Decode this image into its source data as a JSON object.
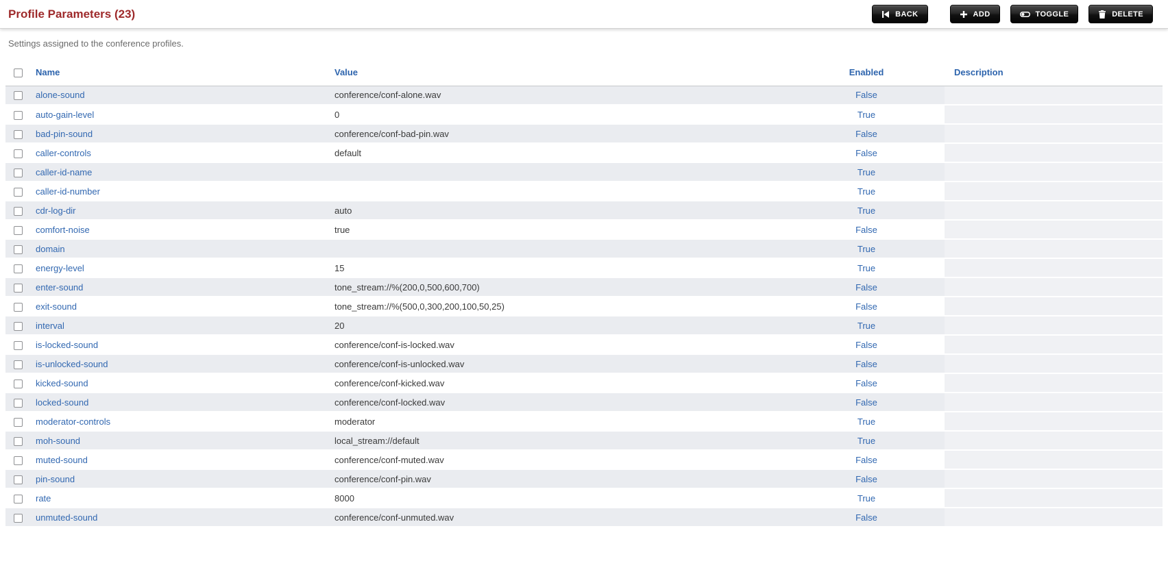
{
  "header": {
    "title": "Profile Parameters (23)",
    "buttons": {
      "back": {
        "label": "BACK",
        "icon": "skip-back-icon"
      },
      "add": {
        "label": "ADD",
        "icon": "plus-icon"
      },
      "toggle": {
        "label": "TOGGLE",
        "icon": "toggle-icon"
      },
      "delete": {
        "label": "DELETE",
        "icon": "trash-icon"
      }
    }
  },
  "subtitle": "Settings assigned to the conference profiles.",
  "table": {
    "columns": [
      "Name",
      "Value",
      "Enabled",
      "Description"
    ],
    "rows": [
      {
        "name": "alone-sound",
        "value": "conference/conf-alone.wav",
        "enabled": "False",
        "description": ""
      },
      {
        "name": "auto-gain-level",
        "value": "0",
        "enabled": "True",
        "description": ""
      },
      {
        "name": "bad-pin-sound",
        "value": "conference/conf-bad-pin.wav",
        "enabled": "False",
        "description": ""
      },
      {
        "name": "caller-controls",
        "value": "default",
        "enabled": "False",
        "description": ""
      },
      {
        "name": "caller-id-name",
        "value": "",
        "enabled": "True",
        "description": ""
      },
      {
        "name": "caller-id-number",
        "value": "",
        "enabled": "True",
        "description": ""
      },
      {
        "name": "cdr-log-dir",
        "value": "auto",
        "enabled": "True",
        "description": ""
      },
      {
        "name": "comfort-noise",
        "value": "true",
        "enabled": "False",
        "description": ""
      },
      {
        "name": "domain",
        "value": "",
        "enabled": "True",
        "description": ""
      },
      {
        "name": "energy-level",
        "value": "15",
        "enabled": "True",
        "description": ""
      },
      {
        "name": "enter-sound",
        "value": "tone_stream://%(200,0,500,600,700)",
        "enabled": "False",
        "description": ""
      },
      {
        "name": "exit-sound",
        "value": "tone_stream://%(500,0,300,200,100,50,25)",
        "enabled": "False",
        "description": ""
      },
      {
        "name": "interval",
        "value": "20",
        "enabled": "True",
        "description": ""
      },
      {
        "name": "is-locked-sound",
        "value": "conference/conf-is-locked.wav",
        "enabled": "False",
        "description": ""
      },
      {
        "name": "is-unlocked-sound",
        "value": "conference/conf-is-unlocked.wav",
        "enabled": "False",
        "description": ""
      },
      {
        "name": "kicked-sound",
        "value": "conference/conf-kicked.wav",
        "enabled": "False",
        "description": ""
      },
      {
        "name": "locked-sound",
        "value": "conference/conf-locked.wav",
        "enabled": "False",
        "description": ""
      },
      {
        "name": "moderator-controls",
        "value": "moderator",
        "enabled": "True",
        "description": ""
      },
      {
        "name": "moh-sound",
        "value": "local_stream://default",
        "enabled": "True",
        "description": ""
      },
      {
        "name": "muted-sound",
        "value": "conference/conf-muted.wav",
        "enabled": "False",
        "description": ""
      },
      {
        "name": "pin-sound",
        "value": "conference/conf-pin.wav",
        "enabled": "False",
        "description": ""
      },
      {
        "name": "rate",
        "value": "8000",
        "enabled": "True",
        "description": ""
      },
      {
        "name": "unmuted-sound",
        "value": "conference/conf-unmuted.wav",
        "enabled": "False",
        "description": ""
      }
    ]
  },
  "colors": {
    "title_red": "#9e2a2b",
    "link_blue": "#3268b1",
    "header_blue": "#2d64ad",
    "stripe_gray": "#eaecf0",
    "description_gray": "#f0f1f4",
    "button_dark": "#1a1a1a"
  }
}
